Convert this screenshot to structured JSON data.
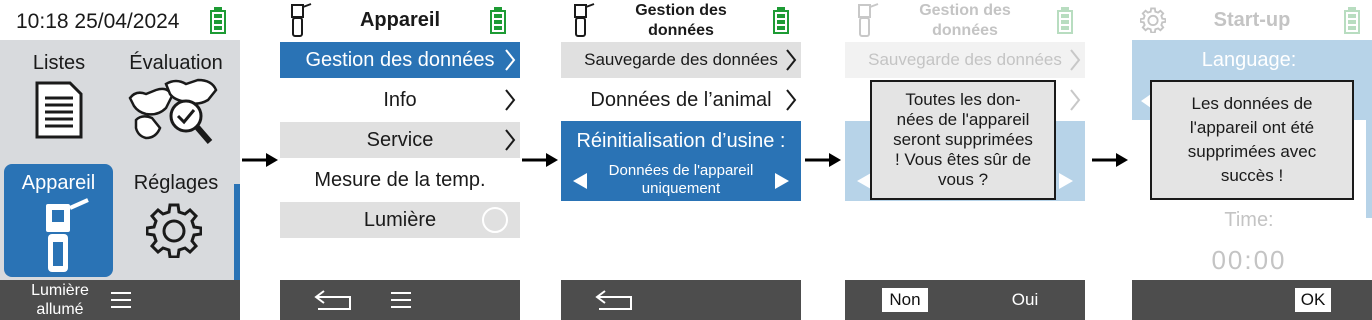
{
  "screen1": {
    "datetime": "10:18 25/04/2024",
    "tiles": {
      "lists": "Listes",
      "evaluation": "Évaluation",
      "device": "Appareil",
      "settings": "Réglages"
    },
    "bottom": {
      "light_label": "Lumière\nallumé"
    }
  },
  "screen2": {
    "title": "Appareil",
    "items": [
      {
        "label": "Gestion des données"
      },
      {
        "label": "Info"
      },
      {
        "label": "Service"
      },
      {
        "label": "Mesure de la temp."
      },
      {
        "label": "Lumière"
      }
    ]
  },
  "screen3": {
    "title": "Gestion des\ndonnées",
    "items": [
      {
        "label": "Sauvegarde des données"
      },
      {
        "label": "Données de l’animal"
      }
    ],
    "selector": {
      "label": "Réinitialisation d’usine :",
      "value": "Données de l'appareil\nuniquement"
    }
  },
  "screen4": {
    "title": "Gestion des\ndonnées",
    "item": "Sauvegarde des données",
    "dialog": "Toutes les don-\nnées de l'appareil\nseront supprimées\n! Vous êtes sûr de\nvous ?",
    "no_label": "Non",
    "yes_label": "Oui"
  },
  "screen5": {
    "title": "Start-up",
    "language_label": "Language:",
    "dialog": "Les données de\nl'appareil ont été\nsupprimées avec\nsuccès !",
    "time_label": "Time:",
    "time_value": "00:00",
    "ok_label": "OK"
  },
  "colors": {
    "accent_blue": "#2a73b5",
    "battery_green": "#1d9b34",
    "bottom_bar": "#4d4d4d",
    "light_blue": "#b7d3e8"
  }
}
